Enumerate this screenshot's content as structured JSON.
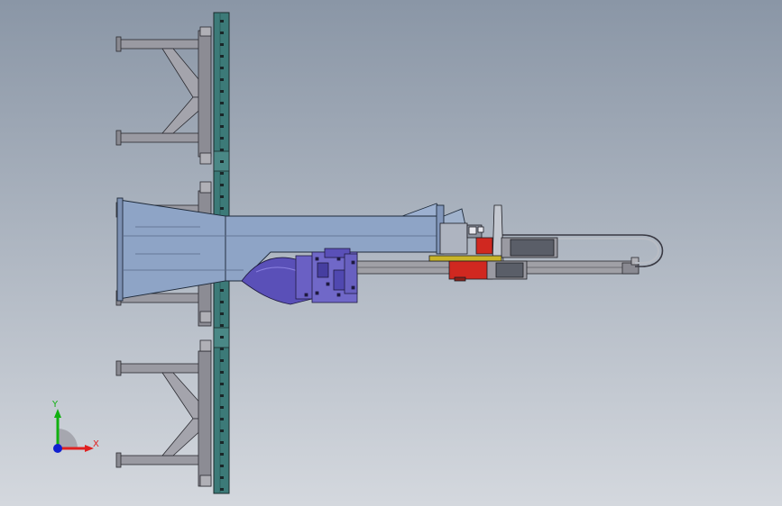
{
  "triad": {
    "x_label": "X",
    "y_label": "Y",
    "x_color": "#e02020",
    "y_color": "#10b010",
    "z_color": "#1020d0"
  },
  "colors": {
    "background_top": "#8a96a6",
    "background_bottom": "#d4d8de",
    "column_steel": "#3c7a78",
    "frame_steel": "#9a9aa2",
    "beam_blue": "#8ea4c6",
    "carriage_purple": "#5a50b8",
    "motor_red": "#d02820",
    "rail_gray": "#a0a0a6",
    "bracket_yellow": "#c8b428"
  }
}
